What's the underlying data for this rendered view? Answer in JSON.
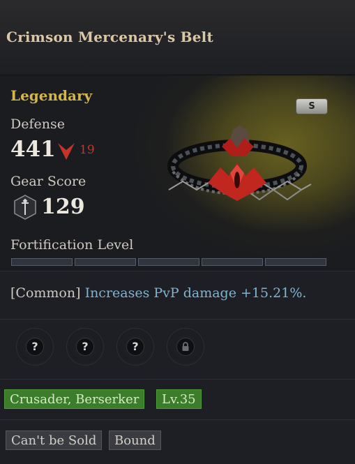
{
  "item": {
    "name": "Crimson Mercenary's Belt",
    "grade": "Legendary",
    "tier_badge": "S",
    "grade_color": "#d3b64d"
  },
  "stats": {
    "defense_label": "Defense",
    "defense_value": "441",
    "defense_diff": "19",
    "defense_diff_direction": "down",
    "gear_score_label": "Gear Score",
    "gear_score_value": "129"
  },
  "fortification": {
    "label": "Fortification Level",
    "segments_total": 5,
    "segments_filled": 0
  },
  "effect": {
    "prefix": "[Common]",
    "text": "Increases PvP damage +15.21%."
  },
  "sockets": [
    {
      "symbol": "?",
      "icon": "question-icon"
    },
    {
      "symbol": "?",
      "icon": "question-icon"
    },
    {
      "symbol": "?",
      "icon": "question-icon"
    },
    {
      "symbol": "",
      "icon": "lock-icon"
    }
  ],
  "class_tags": {
    "classes": "Crusader, Berserker",
    "level": "Lv.35"
  },
  "trade_tags": {
    "sell": "Can't be Sold",
    "bound": "Bound"
  },
  "colors": {
    "accent_green": "#3c7d2b",
    "effect_blue": "#7fb4d2",
    "diff_red": "#c7332c"
  }
}
